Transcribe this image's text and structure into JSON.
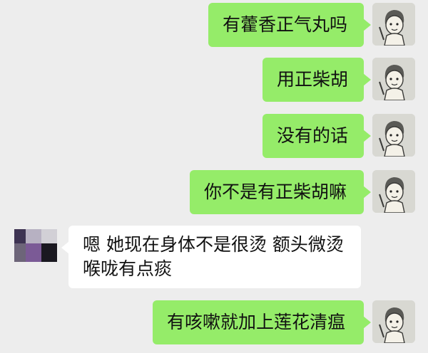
{
  "messages": [
    {
      "direction": "out",
      "text": "有藿香正气丸吗"
    },
    {
      "direction": "out",
      "text": "用正柴胡"
    },
    {
      "direction": "out",
      "text": "没有的话"
    },
    {
      "direction": "out",
      "text": "你不是有正柴胡嘛"
    },
    {
      "direction": "in",
      "lines": [
        "嗯  她现在身体不是很烫  额头微烫",
        "喉咙有点痰"
      ]
    },
    {
      "direction": "out",
      "text": "有咳嗽就加上莲花清瘟"
    }
  ],
  "colors": {
    "background": "#ededed",
    "outgoing_bubble": "#95ec69",
    "incoming_bubble": "#ffffff",
    "text": "#111111"
  },
  "avatars": {
    "self": "cartoon-boy-avatar-icon",
    "contact": "pixelated-avatar-icon"
  }
}
